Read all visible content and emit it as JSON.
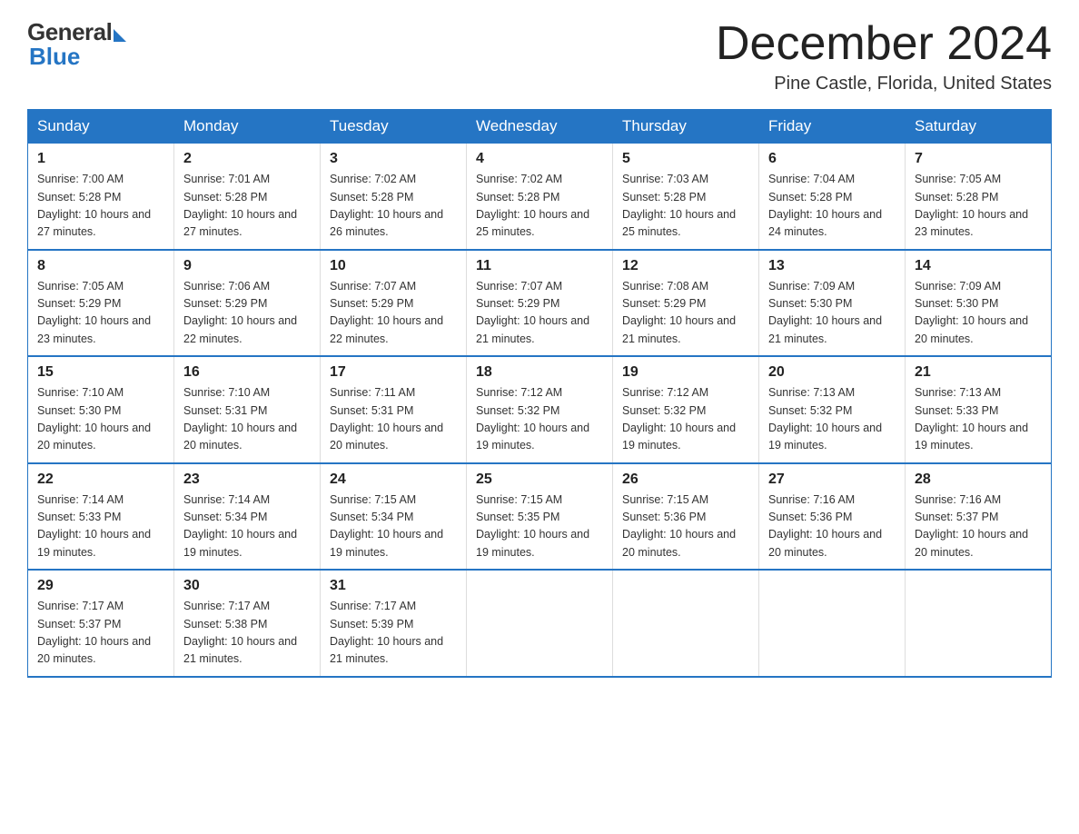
{
  "logo": {
    "general": "General",
    "blue": "Blue"
  },
  "title": "December 2024",
  "location": "Pine Castle, Florida, United States",
  "headers": [
    "Sunday",
    "Monday",
    "Tuesday",
    "Wednesday",
    "Thursday",
    "Friday",
    "Saturday"
  ],
  "weeks": [
    [
      {
        "day": "1",
        "sunrise": "7:00 AM",
        "sunset": "5:28 PM",
        "daylight": "10 hours and 27 minutes."
      },
      {
        "day": "2",
        "sunrise": "7:01 AM",
        "sunset": "5:28 PM",
        "daylight": "10 hours and 27 minutes."
      },
      {
        "day": "3",
        "sunrise": "7:02 AM",
        "sunset": "5:28 PM",
        "daylight": "10 hours and 26 minutes."
      },
      {
        "day": "4",
        "sunrise": "7:02 AM",
        "sunset": "5:28 PM",
        "daylight": "10 hours and 25 minutes."
      },
      {
        "day": "5",
        "sunrise": "7:03 AM",
        "sunset": "5:28 PM",
        "daylight": "10 hours and 25 minutes."
      },
      {
        "day": "6",
        "sunrise": "7:04 AM",
        "sunset": "5:28 PM",
        "daylight": "10 hours and 24 minutes."
      },
      {
        "day": "7",
        "sunrise": "7:05 AM",
        "sunset": "5:28 PM",
        "daylight": "10 hours and 23 minutes."
      }
    ],
    [
      {
        "day": "8",
        "sunrise": "7:05 AM",
        "sunset": "5:29 PM",
        "daylight": "10 hours and 23 minutes."
      },
      {
        "day": "9",
        "sunrise": "7:06 AM",
        "sunset": "5:29 PM",
        "daylight": "10 hours and 22 minutes."
      },
      {
        "day": "10",
        "sunrise": "7:07 AM",
        "sunset": "5:29 PM",
        "daylight": "10 hours and 22 minutes."
      },
      {
        "day": "11",
        "sunrise": "7:07 AM",
        "sunset": "5:29 PM",
        "daylight": "10 hours and 21 minutes."
      },
      {
        "day": "12",
        "sunrise": "7:08 AM",
        "sunset": "5:29 PM",
        "daylight": "10 hours and 21 minutes."
      },
      {
        "day": "13",
        "sunrise": "7:09 AM",
        "sunset": "5:30 PM",
        "daylight": "10 hours and 21 minutes."
      },
      {
        "day": "14",
        "sunrise": "7:09 AM",
        "sunset": "5:30 PM",
        "daylight": "10 hours and 20 minutes."
      }
    ],
    [
      {
        "day": "15",
        "sunrise": "7:10 AM",
        "sunset": "5:30 PM",
        "daylight": "10 hours and 20 minutes."
      },
      {
        "day": "16",
        "sunrise": "7:10 AM",
        "sunset": "5:31 PM",
        "daylight": "10 hours and 20 minutes."
      },
      {
        "day": "17",
        "sunrise": "7:11 AM",
        "sunset": "5:31 PM",
        "daylight": "10 hours and 20 minutes."
      },
      {
        "day": "18",
        "sunrise": "7:12 AM",
        "sunset": "5:32 PM",
        "daylight": "10 hours and 19 minutes."
      },
      {
        "day": "19",
        "sunrise": "7:12 AM",
        "sunset": "5:32 PM",
        "daylight": "10 hours and 19 minutes."
      },
      {
        "day": "20",
        "sunrise": "7:13 AM",
        "sunset": "5:32 PM",
        "daylight": "10 hours and 19 minutes."
      },
      {
        "day": "21",
        "sunrise": "7:13 AM",
        "sunset": "5:33 PM",
        "daylight": "10 hours and 19 minutes."
      }
    ],
    [
      {
        "day": "22",
        "sunrise": "7:14 AM",
        "sunset": "5:33 PM",
        "daylight": "10 hours and 19 minutes."
      },
      {
        "day": "23",
        "sunrise": "7:14 AM",
        "sunset": "5:34 PM",
        "daylight": "10 hours and 19 minutes."
      },
      {
        "day": "24",
        "sunrise": "7:15 AM",
        "sunset": "5:34 PM",
        "daylight": "10 hours and 19 minutes."
      },
      {
        "day": "25",
        "sunrise": "7:15 AM",
        "sunset": "5:35 PM",
        "daylight": "10 hours and 19 minutes."
      },
      {
        "day": "26",
        "sunrise": "7:15 AM",
        "sunset": "5:36 PM",
        "daylight": "10 hours and 20 minutes."
      },
      {
        "day": "27",
        "sunrise": "7:16 AM",
        "sunset": "5:36 PM",
        "daylight": "10 hours and 20 minutes."
      },
      {
        "day": "28",
        "sunrise": "7:16 AM",
        "sunset": "5:37 PM",
        "daylight": "10 hours and 20 minutes."
      }
    ],
    [
      {
        "day": "29",
        "sunrise": "7:17 AM",
        "sunset": "5:37 PM",
        "daylight": "10 hours and 20 minutes."
      },
      {
        "day": "30",
        "sunrise": "7:17 AM",
        "sunset": "5:38 PM",
        "daylight": "10 hours and 21 minutes."
      },
      {
        "day": "31",
        "sunrise": "7:17 AM",
        "sunset": "5:39 PM",
        "daylight": "10 hours and 21 minutes."
      },
      null,
      null,
      null,
      null
    ]
  ]
}
